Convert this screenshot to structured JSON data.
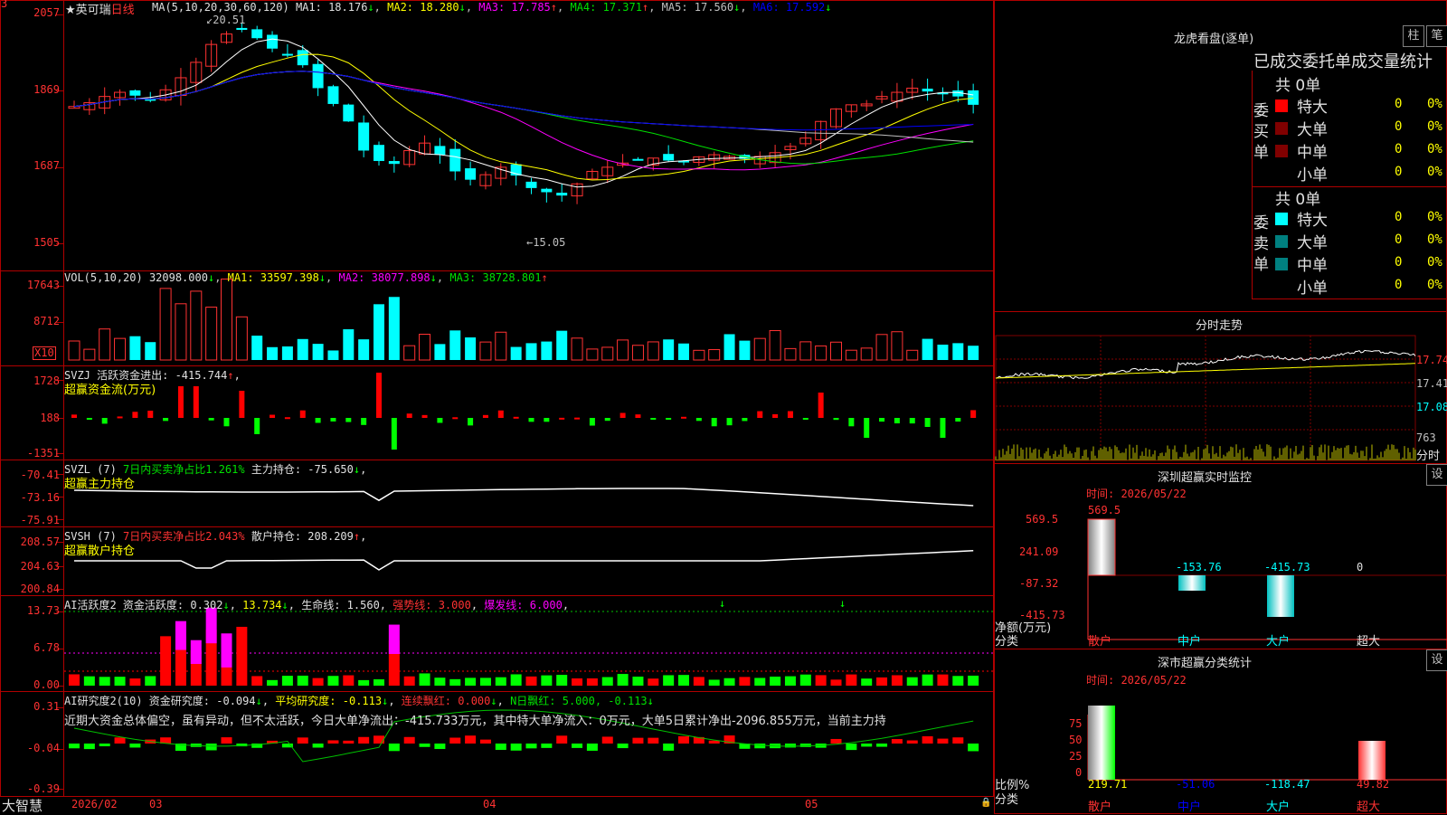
{
  "app": {
    "brand": "大智慧",
    "stock_name": "英可瑞",
    "period": "日线"
  },
  "colors": {
    "up": "#ff3232",
    "down": "#00ffff",
    "bg": "#000000",
    "grid": "#800000",
    "ma1": "#ffffff",
    "ma2": "#ffff00",
    "ma3": "#ff00ff",
    "ma4": "#00e000",
    "ma5": "#c0c0c0",
    "ma6": "#0000ff",
    "label_yellow": "#ffff00"
  },
  "main": {
    "ma_caption": "MA(5,10,20,30,60,120)",
    "ma1": "MA1: 18.176",
    "ma2": "MA2: 18.280",
    "ma3": "MA3: 17.785",
    "ma4": "MA4: 17.371",
    "ma5": "MA5: 17.560",
    "ma6": "MA6: 17.592",
    "y_ticks": [
      "2057",
      "1869",
      "1687",
      "1505"
    ],
    "high_mark": "20.51",
    "low_mark": "←15.05",
    "corner": "3"
  },
  "vol": {
    "caption": "VOL(5,10,20)",
    "value": "32098.000",
    "ma1": "MA1: 33597.398",
    "ma2": "MA2: 38077.898",
    "ma3": "MA3: 38728.801",
    "y_ticks": [
      "17643",
      "8712"
    ],
    "unit": "X10"
  },
  "svzj": {
    "caption": "SVZJ  活跃资金进出: -415.744",
    "subtitle": "超赢资金流(万元)",
    "y_ticks": [
      "1728",
      "188",
      "-1351"
    ]
  },
  "svzl": {
    "caption": "SVZL (7)",
    "ratio": "7日内买卖净占比1.261%",
    "hold": "主力持仓: -75.650",
    "subtitle": "超赢主力持仓",
    "y_ticks": [
      "-70.41",
      "-73.16",
      "-75.91"
    ]
  },
  "svsh": {
    "caption": "SVSH (7)",
    "ratio": "7日内买卖净占比2.043%",
    "hold": "散户持仓: 208.209",
    "subtitle": "超赢散户持仓",
    "y_ticks": [
      "208.57",
      "204.63",
      "200.84"
    ]
  },
  "ai1": {
    "caption": "AI活跃度2 资金活跃度: 0.302",
    "v2": "13.734",
    "life": "生命线: 1.560",
    "strong": "强势线: 3.000",
    "burst": "爆发线: 6.000",
    "y_ticks": [
      "13.73",
      "6.78",
      "0.00"
    ]
  },
  "ai2": {
    "caption": "AI研究度2(10) 资金研究度: -0.094",
    "avg": "平均研究度: -0.113",
    "cont": "连续飘红: 0.000",
    "nday": "N日飘红: 5.000, -0.113",
    "y_ticks": [
      "0.31",
      "-0.04",
      "-0.39"
    ],
    "note": "近期大资金总体偏空，虽有异动，但不太活跃，今日大单净流出：-415.733万元，其中特大单净流入：0万元，大单5日累计净出-2096.855万元，当前主力持"
  },
  "xaxis": {
    "labels": [
      "2026/02",
      "03",
      "04",
      "05"
    ]
  },
  "right": {
    "lhb_title": "龙虎看盘(逐单)",
    "tab_zhu": "柱",
    "tab_bi": "笔",
    "stat_title": "已成交委托单成交量统计",
    "buy_label": "委买单",
    "sell_label": "委卖单",
    "buy_total": "共 0单",
    "sell_total": "共 0单",
    "rows": [
      {
        "label": "特大",
        "n": "0",
        "pct": "0%"
      },
      {
        "label": "大单",
        "n": "0",
        "pct": "0%"
      },
      {
        "label": "中单",
        "n": "0",
        "pct": "0%"
      },
      {
        "label": "小单",
        "n": "0",
        "pct": "0%"
      }
    ],
    "intraday_title": "分时走势",
    "intraday_ticks": [
      "17.74",
      "17.41",
      "17.08"
    ],
    "intraday_vol": "763",
    "intraday_unit": "分时",
    "sz_title": "深圳超赢实时监控",
    "sz_time": "时间: 2026/05/22",
    "set_label": "设",
    "sz_ticks": [
      "569.5",
      "241.09",
      "-87.32",
      "-415.73"
    ],
    "sz_values": [
      "569.5",
      "-153.76",
      "-415.73",
      "0"
    ],
    "sz_axis_label": "净额(万元)",
    "sz_cat_label": "分类",
    "categories": [
      "散户",
      "中户",
      "大户",
      "超大"
    ],
    "cls_title": "深市超赢分类统计",
    "cls_time": "时间: 2026/05/22",
    "cls_ticks": [
      "75",
      "50",
      "25",
      "0"
    ],
    "cls_axis_label": "比例%",
    "cls_cat_label": "分类",
    "cls_values": [
      "219.71",
      "-51.06",
      "-118.47",
      "49.82"
    ]
  }
}
